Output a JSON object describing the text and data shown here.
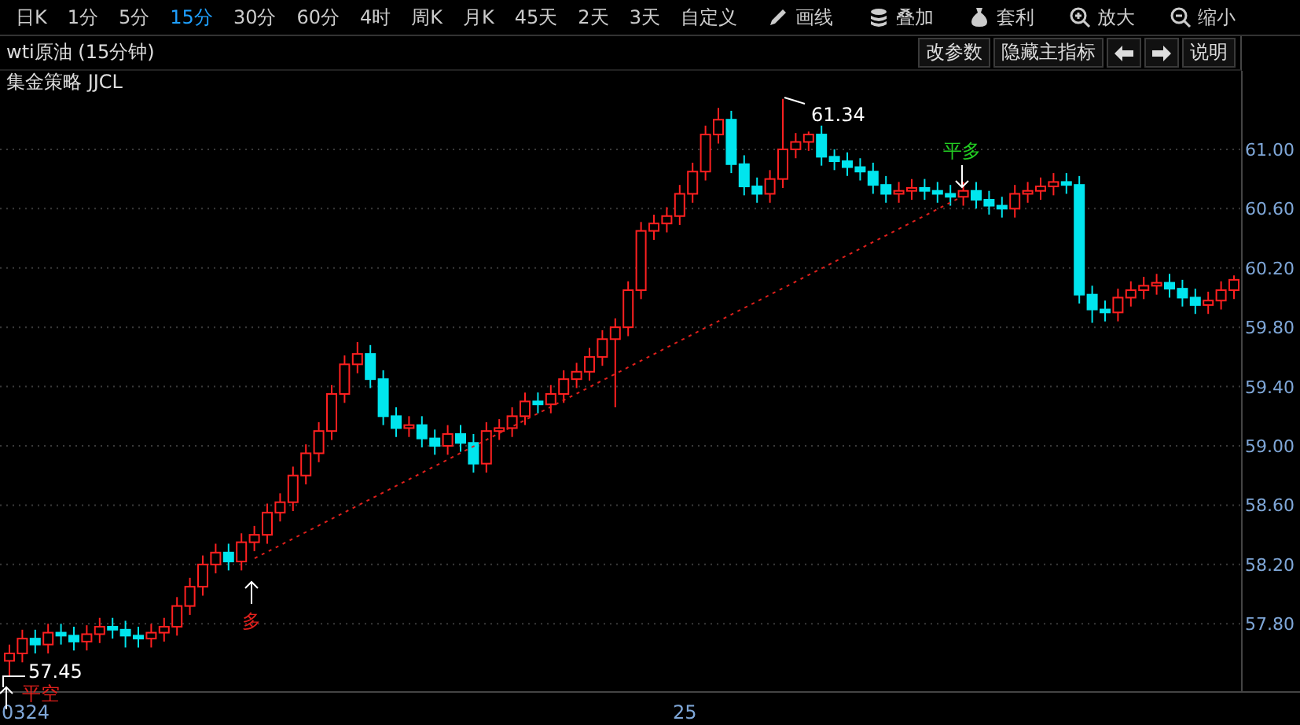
{
  "toolbar": {
    "periods": [
      {
        "label": "日K",
        "selected": false
      },
      {
        "label": "1分",
        "selected": false
      },
      {
        "label": "5分",
        "selected": false
      },
      {
        "label": "15分",
        "selected": true
      },
      {
        "label": "30分",
        "selected": false
      },
      {
        "label": "60分",
        "selected": false
      },
      {
        "label": "4时",
        "selected": false
      },
      {
        "label": "周K",
        "selected": false
      },
      {
        "label": "月K",
        "selected": false
      },
      {
        "label": "45天",
        "selected": false
      },
      {
        "label": "2天",
        "selected": false
      },
      {
        "label": "3天",
        "selected": false
      },
      {
        "label": "自定义",
        "selected": false
      }
    ],
    "tools": [
      {
        "label": "画线"
      },
      {
        "label": "叠加"
      },
      {
        "label": "套利"
      },
      {
        "label": "放大"
      },
      {
        "label": "缩小"
      }
    ]
  },
  "chart_header": {
    "title": "wti原油 (15分钟)",
    "buttons": [
      {
        "kind": "text",
        "label": "改参数"
      },
      {
        "kind": "text",
        "label": "隐藏主指标"
      },
      {
        "kind": "left"
      },
      {
        "kind": "right"
      },
      {
        "kind": "text",
        "label": "说明"
      }
    ]
  },
  "strategy": "集金策略 JJCL",
  "chart": {
    "chart_data": {
      "type": "candlestick",
      "ohlc": [
        [
          57.55,
          57.66,
          57.45,
          57.6
        ],
        [
          57.6,
          57.76,
          57.54,
          57.7
        ],
        [
          57.7,
          57.76,
          57.6,
          57.66
        ],
        [
          57.66,
          57.8,
          57.6,
          57.74
        ],
        [
          57.74,
          57.8,
          57.66,
          57.72
        ],
        [
          57.72,
          57.78,
          57.62,
          57.68
        ],
        [
          57.68,
          57.79,
          57.62,
          57.73
        ],
        [
          57.73,
          57.84,
          57.67,
          57.78
        ],
        [
          57.78,
          57.84,
          57.7,
          57.76
        ],
        [
          57.76,
          57.82,
          57.64,
          57.72
        ],
        [
          57.72,
          57.78,
          57.64,
          57.7
        ],
        [
          57.7,
          57.8,
          57.64,
          57.74
        ],
        [
          57.74,
          57.84,
          57.68,
          57.78
        ],
        [
          57.78,
          57.98,
          57.72,
          57.92
        ],
        [
          57.92,
          58.11,
          57.86,
          58.05
        ],
        [
          58.05,
          58.26,
          57.99,
          58.2
        ],
        [
          58.2,
          58.34,
          58.14,
          58.28
        ],
        [
          58.28,
          58.34,
          58.16,
          58.22
        ],
        [
          58.22,
          58.41,
          58.16,
          58.35
        ],
        [
          58.35,
          58.46,
          58.29,
          58.4
        ],
        [
          58.4,
          58.61,
          58.34,
          58.55
        ],
        [
          58.55,
          58.68,
          58.49,
          58.62
        ],
        [
          58.62,
          58.86,
          58.56,
          58.8
        ],
        [
          58.8,
          59.01,
          58.74,
          58.95
        ],
        [
          58.95,
          59.16,
          58.89,
          59.1
        ],
        [
          59.1,
          59.41,
          59.04,
          59.35
        ],
        [
          59.35,
          59.61,
          59.29,
          59.55
        ],
        [
          59.55,
          59.7,
          59.49,
          59.62
        ],
        [
          59.62,
          59.68,
          59.39,
          59.45
        ],
        [
          59.45,
          59.51,
          59.14,
          59.2
        ],
        [
          59.2,
          59.26,
          59.06,
          59.12
        ],
        [
          59.12,
          59.2,
          59.06,
          59.14
        ],
        [
          59.14,
          59.2,
          58.99,
          59.05
        ],
        [
          59.05,
          59.11,
          58.94,
          59.0
        ],
        [
          59.0,
          59.14,
          58.94,
          59.08
        ],
        [
          59.08,
          59.14,
          58.96,
          59.02
        ],
        [
          59.02,
          59.08,
          58.82,
          58.88
        ],
        [
          58.88,
          59.16,
          58.82,
          59.1
        ],
        [
          59.1,
          59.18,
          59.04,
          59.12
        ],
        [
          59.12,
          59.26,
          59.06,
          59.2
        ],
        [
          59.2,
          59.36,
          59.14,
          59.3
        ],
        [
          59.3,
          59.36,
          59.22,
          59.28
        ],
        [
          59.28,
          59.41,
          59.22,
          59.35
        ],
        [
          59.35,
          59.51,
          59.29,
          59.45
        ],
        [
          59.45,
          59.56,
          59.39,
          59.5
        ],
        [
          59.5,
          59.66,
          59.44,
          59.6
        ],
        [
          59.6,
          59.78,
          59.54,
          59.72
        ],
        [
          59.72,
          59.86,
          59.26,
          59.8
        ],
        [
          59.8,
          60.11,
          59.74,
          60.05
        ],
        [
          60.05,
          60.51,
          59.99,
          60.45
        ],
        [
          60.45,
          60.56,
          60.39,
          60.5
        ],
        [
          60.5,
          60.61,
          60.44,
          60.55
        ],
        [
          60.55,
          60.76,
          60.49,
          60.7
        ],
        [
          60.7,
          60.91,
          60.64,
          60.85
        ],
        [
          60.85,
          61.16,
          60.79,
          61.1
        ],
        [
          61.1,
          61.28,
          61.04,
          61.2
        ],
        [
          61.2,
          61.26,
          60.84,
          60.9
        ],
        [
          60.9,
          60.96,
          60.69,
          60.75
        ],
        [
          60.75,
          60.81,
          60.64,
          60.7
        ],
        [
          60.7,
          60.86,
          60.64,
          60.8
        ],
        [
          60.8,
          61.34,
          60.74,
          61.0
        ],
        [
          61.0,
          61.11,
          60.94,
          61.05
        ],
        [
          61.05,
          61.12,
          60.99,
          61.1
        ],
        [
          61.1,
          61.16,
          60.89,
          60.95
        ],
        [
          60.95,
          61.0,
          60.86,
          60.92
        ],
        [
          60.92,
          60.98,
          60.82,
          60.88
        ],
        [
          60.88,
          60.94,
          60.79,
          60.85
        ],
        [
          60.85,
          60.91,
          60.7,
          60.76
        ],
        [
          60.76,
          60.82,
          60.64,
          60.7
        ],
        [
          60.7,
          60.78,
          60.64,
          60.72
        ],
        [
          60.72,
          60.8,
          60.66,
          60.74
        ],
        [
          60.74,
          60.8,
          60.66,
          60.72
        ],
        [
          60.72,
          60.78,
          60.64,
          60.7
        ],
        [
          60.7,
          60.76,
          60.62,
          60.68
        ],
        [
          60.68,
          60.78,
          60.62,
          60.72
        ],
        [
          60.72,
          60.78,
          60.6,
          60.66
        ],
        [
          60.66,
          60.72,
          60.56,
          60.62
        ],
        [
          60.62,
          60.68,
          60.54,
          60.6
        ],
        [
          60.6,
          60.76,
          60.54,
          60.7
        ],
        [
          60.7,
          60.78,
          60.64,
          60.72
        ],
        [
          60.72,
          60.81,
          60.66,
          60.75
        ],
        [
          60.75,
          60.84,
          60.69,
          60.78
        ],
        [
          60.78,
          60.84,
          60.7,
          60.76
        ],
        [
          60.76,
          60.82,
          59.96,
          60.02
        ],
        [
          60.02,
          60.08,
          59.83,
          59.92
        ],
        [
          59.92,
          59.98,
          59.84,
          59.9
        ],
        [
          59.9,
          60.06,
          59.84,
          60.0
        ],
        [
          60.0,
          60.11,
          59.94,
          60.05
        ],
        [
          60.05,
          60.14,
          59.99,
          60.08
        ],
        [
          60.08,
          60.16,
          60.02,
          60.1
        ],
        [
          60.1,
          60.16,
          60.0,
          60.06
        ],
        [
          60.06,
          60.12,
          59.94,
          60.0
        ],
        [
          60.0,
          60.06,
          59.89,
          59.95
        ],
        [
          59.95,
          60.04,
          59.89,
          59.98
        ],
        [
          59.98,
          60.11,
          59.92,
          60.05
        ],
        [
          60.05,
          60.15,
          59.99,
          60.12
        ]
      ],
      "yticks": [
        {
          "value": 61.0,
          "label": "61.00"
        },
        {
          "value": 60.6,
          "label": "60.60"
        },
        {
          "value": 60.2,
          "label": "60.20"
        },
        {
          "value": 59.8,
          "label": "59.80"
        },
        {
          "value": 59.4,
          "label": "59.40"
        },
        {
          "value": 59.0,
          "label": "59.00"
        },
        {
          "value": 58.6,
          "label": "58.60"
        },
        {
          "value": 58.2,
          "label": "58.20"
        },
        {
          "value": 57.8,
          "label": "57.80"
        }
      ],
      "ylim": [
        57.34,
        61.53
      ],
      "grid": true
    },
    "x_axis_labels": [
      "0324",
      "25"
    ],
    "high_label": "61.34",
    "low_label": "57.45",
    "signals": [
      {
        "label": "平空",
        "color": "#e0201c",
        "kind": "cover"
      },
      {
        "label": "多",
        "color": "#e0201c",
        "kind": "buy"
      },
      {
        "label": "平多",
        "color": "#22cc22",
        "kind": "sell"
      }
    ]
  }
}
